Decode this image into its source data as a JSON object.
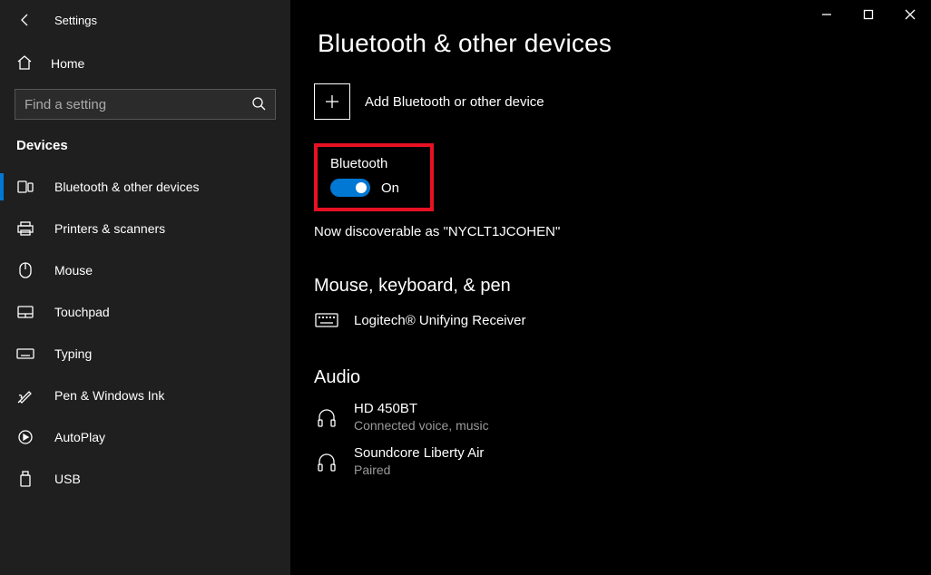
{
  "app_title": "Settings",
  "home_label": "Home",
  "search_placeholder": "Find a setting",
  "section_header": "Devices",
  "sidebar_items": [
    {
      "label": "Bluetooth & other devices"
    },
    {
      "label": "Printers & scanners"
    },
    {
      "label": "Mouse"
    },
    {
      "label": "Touchpad"
    },
    {
      "label": "Typing"
    },
    {
      "label": "Pen & Windows Ink"
    },
    {
      "label": "AutoPlay"
    },
    {
      "label": "USB"
    }
  ],
  "page_title": "Bluetooth & other devices",
  "add_device_label": "Add Bluetooth or other device",
  "bluetooth_section_label": "Bluetooth",
  "toggle_state": "On",
  "discoverable_text": "Now discoverable as \"NYCLT1JCOHEN\"",
  "mouse_header": "Mouse, keyboard, & pen",
  "mouse_device_name": "Logitech® Unifying Receiver",
  "audio_header": "Audio",
  "audio_devices": [
    {
      "name": "HD 450BT",
      "status": "Connected voice, music"
    },
    {
      "name": "Soundcore Liberty Air",
      "status": "Paired"
    }
  ]
}
